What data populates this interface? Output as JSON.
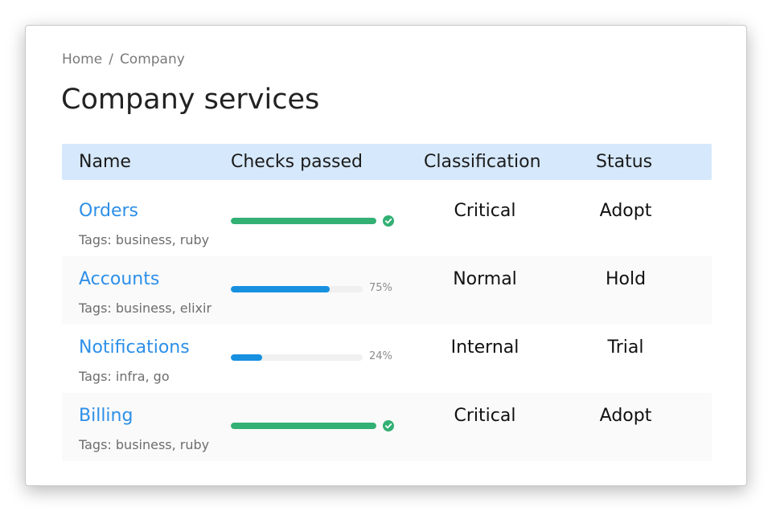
{
  "breadcrumb": {
    "home": "Home",
    "separator": "/",
    "current": "Company"
  },
  "page": {
    "title": "Company services"
  },
  "table": {
    "headers": {
      "name": "Name",
      "checks": "Checks passed",
      "classification": "Classification",
      "status": "Status"
    },
    "rows": [
      {
        "name": "Orders",
        "tags": "Tags: business, ruby",
        "checks_percent": 100,
        "checks_label": "",
        "complete": true,
        "classification": "Critical",
        "status": "Adopt"
      },
      {
        "name": "Accounts",
        "tags": "Tags: business, elixir",
        "checks_percent": 75,
        "checks_label": "75%",
        "complete": false,
        "classification": "Normal",
        "status": "Hold"
      },
      {
        "name": "Notifications",
        "tags": "Tags: infra, go",
        "checks_percent": 24,
        "checks_label": "24%",
        "complete": false,
        "classification": "Internal",
        "status": "Trial"
      },
      {
        "name": "Billing",
        "tags": "Tags: business, ruby",
        "checks_percent": 100,
        "checks_label": "",
        "complete": true,
        "classification": "Critical",
        "status": "Adopt"
      }
    ]
  },
  "colors": {
    "link": "#2d8fe8",
    "progress_active": "#1890e0",
    "progress_success": "#33b074",
    "header_bg": "#d6e8fb"
  }
}
